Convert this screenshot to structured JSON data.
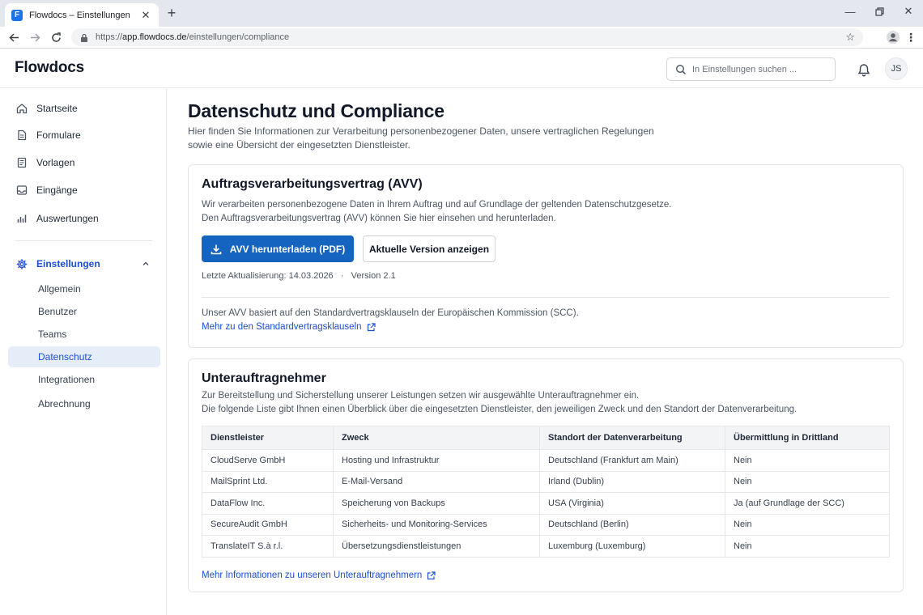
{
  "browser": {
    "tab_title": "Flowdocs – Einstellungen",
    "url_scheme": "https://",
    "url_host": "app.flowdocs.de",
    "url_path": "/einstellungen/compliance"
  },
  "header": {
    "brand": "Flowdocs",
    "search_placeholder": "In Einstellungen suchen ...",
    "avatar_initials": "JS"
  },
  "sidebar": {
    "items": [
      {
        "label": "Startseite",
        "icon": "home-icon"
      },
      {
        "label": "Formulare",
        "icon": "document-icon"
      },
      {
        "label": "Vorlagen",
        "icon": "template-icon"
      },
      {
        "label": "Eingänge",
        "icon": "inbox-icon"
      },
      {
        "label": "Auswertungen",
        "icon": "bar-chart-icon"
      }
    ],
    "section_label": "Einstellungen",
    "sub_items": [
      "Allgemein",
      "Benutzer",
      "Teams",
      "Datenschutz",
      "Integrationen",
      "Abrechnung"
    ],
    "active_sub_item": "Datenschutz"
  },
  "main": {
    "title": "Datenschutz und Compliance",
    "description": "Hier finden Sie Informationen zur Verarbeitung personenbezogener Daten, unsere vertraglichen Regelungen sowie eine Übersicht der eingesetzten Dienstleister.",
    "avv": {
      "title": "Auftragsverarbeitungsvertrag (AVV)",
      "text_line1": "Wir verarbeiten personenbezogene Daten in Ihrem Auftrag und auf Grundlage der geltenden Datenschutzgesetze.",
      "text_line2": "Den Auftragsverarbeitungsvertrag (AVV) können Sie hier einsehen und herunterladen.",
      "download_label": "AVV herunterladen (PDF)",
      "view_label": "Aktuelle Version anzeigen",
      "meta": "Letzte Aktualisierung: 14.03.2026   ·   Version 2.1",
      "scc_text": "Unser AVV basiert auf den Standardvertragsklauseln der Europäischen Kommission (SCC).",
      "scc_link": "Mehr zu den Standardvertragsklauseln"
    },
    "subprocessors": {
      "title": "Unterauftragnehmer",
      "text_line1": "Zur Bereitstellung und Sicherstellung unserer Leistungen setzen wir ausgewählte Unterauftragnehmer ein.",
      "text_line2": "Die folgende Liste gibt Ihnen einen Überblick über die eingesetzten Dienstleister, den jeweiligen Zweck und den Standort der Datenverarbeitung.",
      "columns": [
        "Dienstleister",
        "Zweck",
        "Standort der Datenverarbeitung",
        "Übermittlung in Drittland"
      ],
      "rows": [
        [
          "CloudServe GmbH",
          "Hosting und Infrastruktur",
          "Deutschland (Frankfurt am Main)",
          "Nein"
        ],
        [
          "MailSprint Ltd.",
          "E-Mail-Versand",
          "Irland (Dublin)",
          "Nein"
        ],
        [
          "DataFlow Inc.",
          "Speicherung von Backups",
          "USA (Virginia)",
          "Ja (auf Grundlage der SCC)"
        ],
        [
          "SecureAudit GmbH",
          "Sicherheits- und Monitoring-Services",
          "Deutschland (Berlin)",
          "Nein"
        ],
        [
          "TranslateIT S.à r.l.",
          "Übersetzungsdienstleistungen",
          "Luxemburg (Luxemburg)",
          "Nein"
        ]
      ],
      "more_link": "Mehr Informationen zu unseren Unterauftragnehmern"
    }
  },
  "colors": {
    "accent": "#1565c0",
    "link": "#1d4ed8",
    "active_bg": "#e5edf9"
  }
}
